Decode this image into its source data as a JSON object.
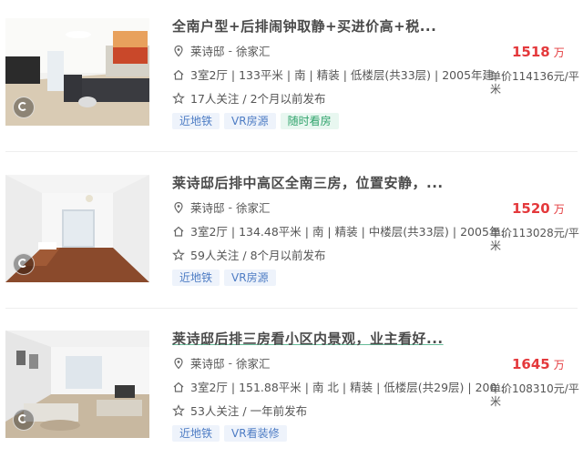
{
  "listings": [
    {
      "title": "全南户型+后排闹钟取静+买进价高+税...",
      "community": "莱诗邸",
      "district": "徐家汇",
      "info": "3室2厅 | 133平米 | 南 | 精装 | 低楼层(共33层) | 2005年建",
      "follow": "17人关注 / 2个月以前发布",
      "price": "1518",
      "price_unit": "万",
      "unit_price": "单价114136元/平米",
      "tags": [
        "近地铁",
        "VR房源",
        "随时看房"
      ]
    },
    {
      "title": "莱诗邸后排中高区全南三房，位置安静，...",
      "community": "莱诗邸",
      "district": "徐家汇",
      "info": "3室2厅 | 134.48平米 | 南 | 精装 | 中楼层(共33层) | 2005年...",
      "follow": "59人关注 / 8个月以前发布",
      "price": "1520",
      "price_unit": "万",
      "unit_price": "单价113028元/平米",
      "tags": [
        "近地铁",
        "VR房源"
      ]
    },
    {
      "title": "莱诗邸后排三房看小区内景观，业主看好...",
      "community": "莱诗邸",
      "district": "徐家汇",
      "info": "3室2厅 | 151.88平米 | 南 北 | 精装 | 低楼层(共29层) | 200...",
      "follow": "53人关注 / 一年前发布",
      "price": "1645",
      "price_unit": "万",
      "unit_price": "单价108310元/平米",
      "tags": [
        "近地铁",
        "VR看装修"
      ]
    }
  ],
  "colors": {
    "price": "#e4393c",
    "tag_blue_bg": "#eef3fb",
    "tag_blue_text": "#4d7cc4",
    "tag_green_bg": "#e8f7f0",
    "tag_green_text": "#2fa36b"
  },
  "icons": {
    "location": "location-pin-icon",
    "info": "house-icon",
    "follow": "star-icon",
    "vr": "vr-360-icon"
  }
}
